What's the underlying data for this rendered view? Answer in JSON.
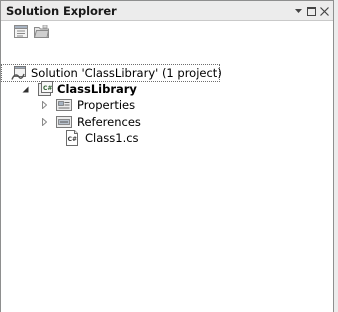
{
  "panel": {
    "title": "Solution Explorer",
    "controls": {
      "dropdown": "dropdown-arrow-icon",
      "maximize": "window-restore-icon",
      "close": "close-icon"
    }
  },
  "toolbar": {
    "buttons": [
      {
        "name": "properties-button",
        "icon": "properties-icon"
      },
      {
        "name": "show-all-files-button",
        "icon": "folder-icon"
      }
    ]
  },
  "tree": {
    "solution": {
      "label": "Solution 'ClassLibrary' (1 project)",
      "icon": "solution-icon"
    },
    "project": {
      "label": "ClassLibrary",
      "icon": "csharp-project-icon",
      "expanded": true,
      "children": [
        {
          "label": "Properties",
          "icon": "properties-folder-icon",
          "expandable": true
        },
        {
          "label": "References",
          "icon": "references-folder-icon",
          "expandable": true
        },
        {
          "label": "Class1.cs",
          "icon": "csharp-file-icon",
          "expandable": false
        }
      ]
    }
  }
}
